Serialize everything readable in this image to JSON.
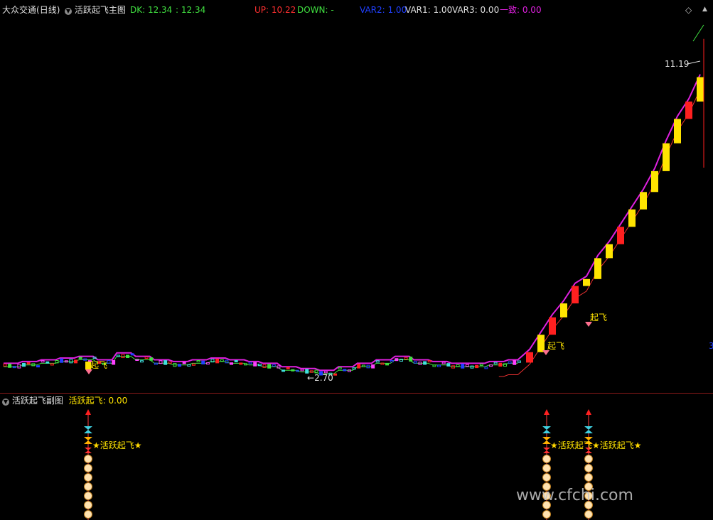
{
  "colors": {
    "bg": "#000000",
    "divider": "#8b1a1a",
    "up_candle": "#ff2020",
    "down_candle": "#ffe400",
    "ma_pink": "#e020e0",
    "ma_green": "#40e040",
    "ma_red": "#e83030",
    "white_text": "#e0e0e0",
    "yellow_text": "#ffe400"
  },
  "header": {
    "stock_name": "大众交通",
    "period": "(日线)",
    "indicator_name": "活跃起飞主图",
    "dk_label": "DK: 12.34",
    "dk_value2": ": 12.34",
    "up_label": "UP: 10.22",
    "down_label": "DOWN: -",
    "var2_label": "VAR2: 1.00",
    "var1_label": "VAR1: 1.00",
    "var3_label": "VAR3: 0.00",
    "yizhi_label": "一致: 0.00",
    "diamond_icon": "◇"
  },
  "main_chart": {
    "high_label": "11.19",
    "low_label": "2.70",
    "right_edge_label": "3",
    "signal_label": "起飞"
  },
  "sub_panel": {
    "indicator_name": "活跃起飞副图",
    "value_label": "活跃起飞: 0.00",
    "signal_text": "活跃起飞",
    "star": "★"
  },
  "watermark": "www.cfchi.com",
  "chart_data": {
    "type": "candlestick",
    "price_min": 2.7,
    "price_max": 12.34,
    "flat_period_close": [
      2.9,
      2.95,
      3.0,
      3.05,
      3.1,
      3.0,
      3.2,
      3.1,
      3.0,
      2.95,
      3.0,
      3.05,
      3.0,
      2.95,
      2.9,
      2.8,
      2.75,
      2.7,
      2.8,
      2.9,
      3.0,
      3.1,
      3.0,
      2.95,
      2.9,
      2.9,
      2.95,
      3.0
    ],
    "rally_close": [
      3.3,
      3.8,
      4.3,
      4.7,
      5.2,
      5.4,
      6.0,
      6.4,
      6.9,
      7.4,
      7.9,
      8.5,
      9.3,
      10.0,
      10.5,
      11.2
    ],
    "signal_positions": [
      "early",
      "rally-start",
      "rally-mid"
    ]
  }
}
